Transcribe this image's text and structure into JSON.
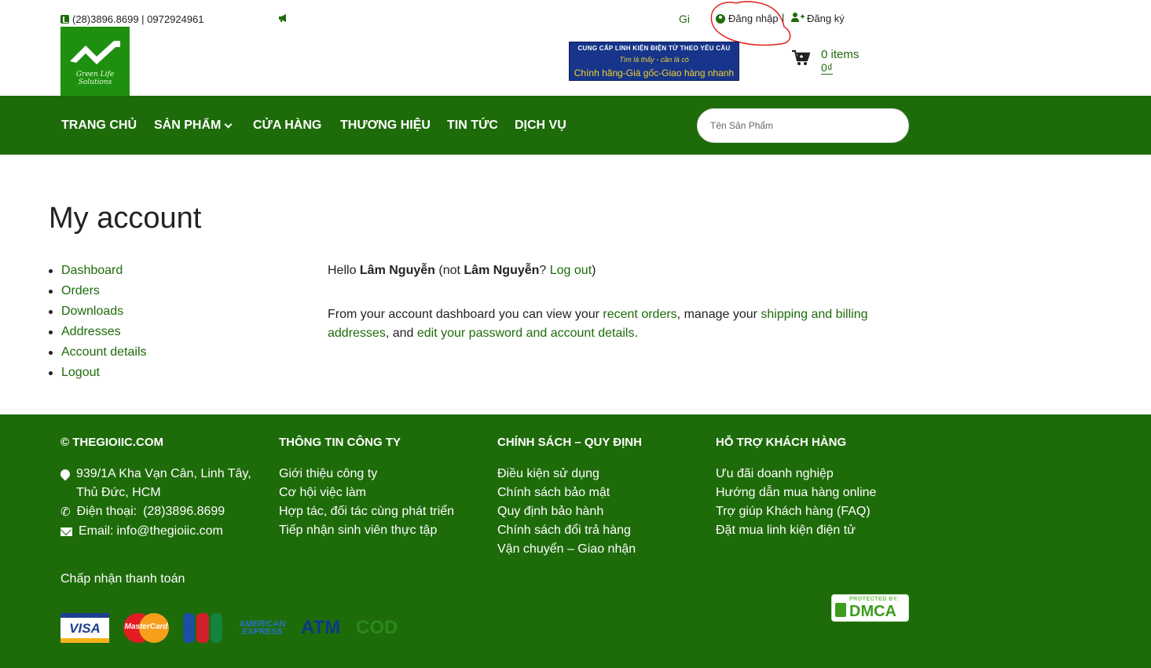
{
  "header": {
    "phone": "(28)3896.8699 | 0972924961",
    "marquee_trunc": "Gi",
    "login": "Đăng nhập",
    "separator": "|",
    "register": "Đăng ký",
    "logo_text": "Green Life Solutions",
    "banner": {
      "line1": "CUNG CẤP LINH KIỆN ĐIỆN TỬ THEO YÊU CẦU",
      "line2": "Tìm là thấy - cần là có",
      "line3": "Chính hãng-Giá gốc-Giao hàng nhanh"
    },
    "cart": {
      "items": "0 items",
      "total": "0₫"
    }
  },
  "nav": {
    "items": [
      "TRANG CHỦ",
      "SẢN PHẨM",
      "CỬA HÀNG",
      "THƯƠNG HIỆU",
      "TIN TỨC",
      "DỊCH VỤ"
    ],
    "search_placeholder": "Tên Sản Phẩm"
  },
  "account": {
    "title": "My account",
    "menu": [
      "Dashboard",
      "Orders",
      "Downloads",
      "Addresses",
      "Account details",
      "Logout"
    ],
    "hello": {
      "prefix": "Hello ",
      "user": "Lâm Nguyễn",
      "not_prefix": " (not ",
      "user2": "Lâm Nguyễn",
      "q": "? ",
      "logout": "Log out",
      "suffix": ")"
    },
    "desc": {
      "p1": "From your account dashboard you can view your ",
      "link1": "recent orders",
      "p2": ", manage your ",
      "link2": "shipping and billing addresses",
      "p3": ", and ",
      "link3": "edit your password and account details",
      "p4": "."
    }
  },
  "footer": {
    "col1": {
      "heading": "© THEGIOIIC.COM",
      "address": "939/1A Kha Vạn Cân, Linh Tây, Thủ Đức, HCM",
      "phone_label": "Điện thoại:",
      "phone": "(28)3896.8699",
      "email_label": "Email:",
      "email": "info@thegioiic.com"
    },
    "col2": {
      "heading": "THÔNG TIN CÔNG TY",
      "items": [
        "Giới thiệu công ty",
        "Cơ hội việc làm",
        "Hợp tác, đối tác cùng phát triển",
        "Tiếp nhận sinh viên thực tập"
      ]
    },
    "col3": {
      "heading": "CHÍNH SÁCH – QUY ĐỊNH",
      "items": [
        "Điều kiện sử dụng",
        "Chính sách bảo mật",
        "Quy định bảo hành",
        "Chính sách đổi trả hàng",
        "Vận chuyển – Giao nhận"
      ]
    },
    "col4": {
      "heading": "HỖ TRỢ KHÁCH HÀNG",
      "items": [
        "Ưu đãi doanh nghiệp",
        "Hướng dẫn mua hàng online",
        "Trợ giúp Khách hàng (FAQ)",
        "Đặt mua linh kiện điện tử"
      ]
    },
    "payment_title": "Chấp nhận thanh toán",
    "payments": {
      "visa": "VISA",
      "mastercard": "MasterCard",
      "amex": "AMERICAN EXPRESS",
      "atm": "ATM",
      "cod": "COD"
    },
    "dmca": {
      "top": "PROTECTED BY:",
      "main": "DMCA"
    }
  },
  "colors": {
    "brand_green": "#1e6b0a",
    "link_green": "#1e6b0a",
    "annotation_red": "#e0201c"
  }
}
